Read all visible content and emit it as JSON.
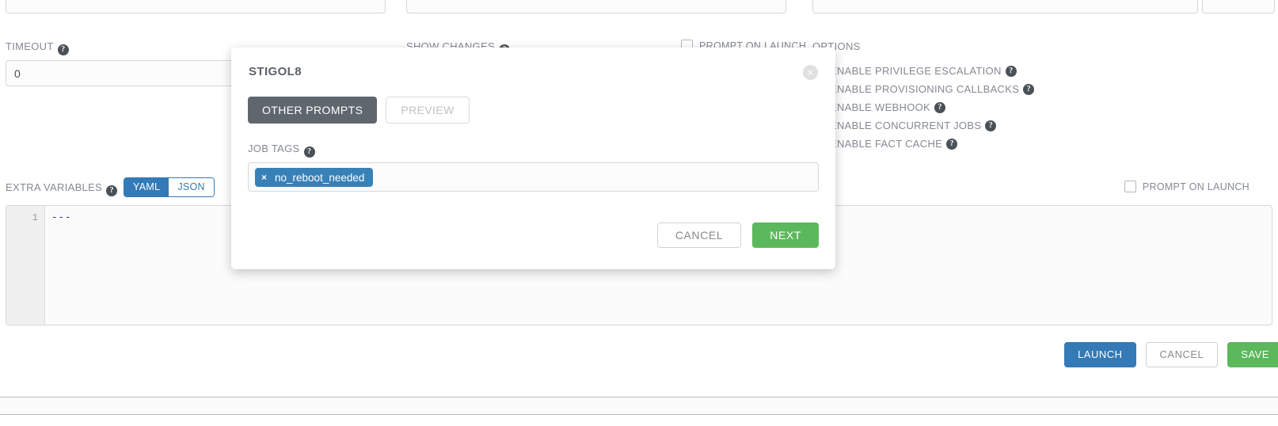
{
  "form": {
    "timeout": {
      "label": "TIMEOUT",
      "value": "0",
      "help": "?"
    },
    "show_changes": {
      "label": "SHOW CHANGES",
      "help": "?"
    },
    "prompt_on_launch_1": {
      "label": "PROMPT ON LAUNCH",
      "checked": false
    },
    "prompt_on_launch_2": {
      "label": "PROMPT ON LAUNCH",
      "checked": false
    },
    "options": {
      "label": "OPTIONS",
      "items": [
        {
          "label": "ENABLE PRIVILEGE ESCALATION",
          "help": "?"
        },
        {
          "label": "ENABLE PROVISIONING CALLBACKS",
          "help": "?"
        },
        {
          "label": "ENABLE WEBHOOK",
          "help": "?"
        },
        {
          "label": "ENABLE CONCURRENT JOBS",
          "help": "?"
        },
        {
          "label": "ENABLE FACT CACHE",
          "help": "?"
        }
      ]
    },
    "extra_variables": {
      "label": "EXTRA VARIABLES",
      "help": "?",
      "format_yaml": "YAML",
      "format_json": "JSON",
      "active_format": "YAML",
      "editor": {
        "line_number": "1",
        "content": "---"
      }
    }
  },
  "actions": {
    "launch_label": "LAUNCH",
    "cancel_label": "CANCEL",
    "save_label": "SAVE"
  },
  "modal": {
    "title": "STIGOL8",
    "close_icon": "×",
    "tabs": [
      {
        "label": "OTHER PROMPTS",
        "active": true
      },
      {
        "label": "PREVIEW",
        "active": false
      }
    ],
    "job_tags": {
      "label": "JOB TAGS",
      "help": "?",
      "tags": [
        {
          "remove_icon": "×",
          "label": "no_reboot_needed"
        }
      ]
    },
    "cancel_label": "CANCEL",
    "next_label": "NEXT"
  },
  "colors": {
    "primary_blue": "#337ab7",
    "success_green": "#5cb85c",
    "tab_active": "#5f666e",
    "tag_blue": "#3881b8"
  }
}
